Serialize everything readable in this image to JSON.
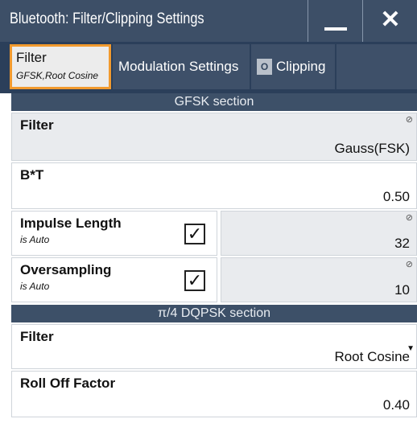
{
  "window": {
    "title": "Bluetooth: Filter/Clipping Settings"
  },
  "tabs": {
    "filter": {
      "label": "Filter",
      "sublabel": "GFSK,Root Cosine"
    },
    "modulation": {
      "label": "Modulation Settings"
    },
    "clipping": {
      "indicator": "O",
      "label": "Clipping"
    }
  },
  "gfsk": {
    "header": "GFSK section",
    "filter": {
      "label": "Filter",
      "value": "Gauss(FSK)"
    },
    "bt": {
      "label": "B*T",
      "value": "0.50"
    },
    "impulse_length": {
      "label": "Impulse Length",
      "auto_label": "is Auto",
      "checked": true,
      "value": "32"
    },
    "oversampling": {
      "label": "Oversampling",
      "auto_label": "is Auto",
      "checked": true,
      "value": "10"
    }
  },
  "dqpsk": {
    "header": "π/4 DQPSK section",
    "filter": {
      "label": "Filter",
      "value": "Root Cosine"
    },
    "roll_off": {
      "label": "Roll Off Factor",
      "value": "0.40"
    }
  },
  "icons": {
    "readonly": "⊘",
    "check": "✓",
    "close": "✕",
    "dropdown": "▼"
  }
}
